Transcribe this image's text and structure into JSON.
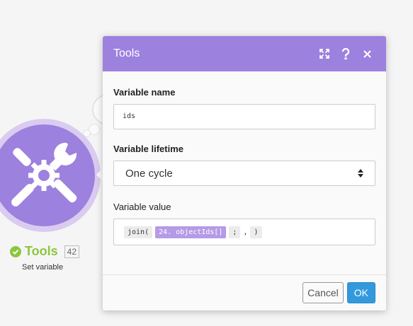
{
  "colors": {
    "accent": "#9d81de",
    "success": "#8cc63f",
    "ok": "#3399dd"
  },
  "module": {
    "name": "Tools",
    "id": "42",
    "subtitle": "Set variable",
    "icon": "wrench-screwdriver-gear-icon"
  },
  "dialog": {
    "title": "Tools",
    "header_icons": [
      "expand-icon",
      "help-icon",
      "close-icon"
    ],
    "fields": {
      "name_label": "Variable name",
      "name_value": "ids",
      "lifetime_label": "Variable lifetime",
      "lifetime_value": "One cycle",
      "value_label": "Variable value",
      "value_tokens": {
        "fn_open": "join(",
        "mapped": "24. objectIds[]",
        "separator": ";",
        "comma": ",",
        "fn_close": ")"
      }
    },
    "buttons": {
      "cancel": "Cancel",
      "ok": "OK"
    }
  }
}
